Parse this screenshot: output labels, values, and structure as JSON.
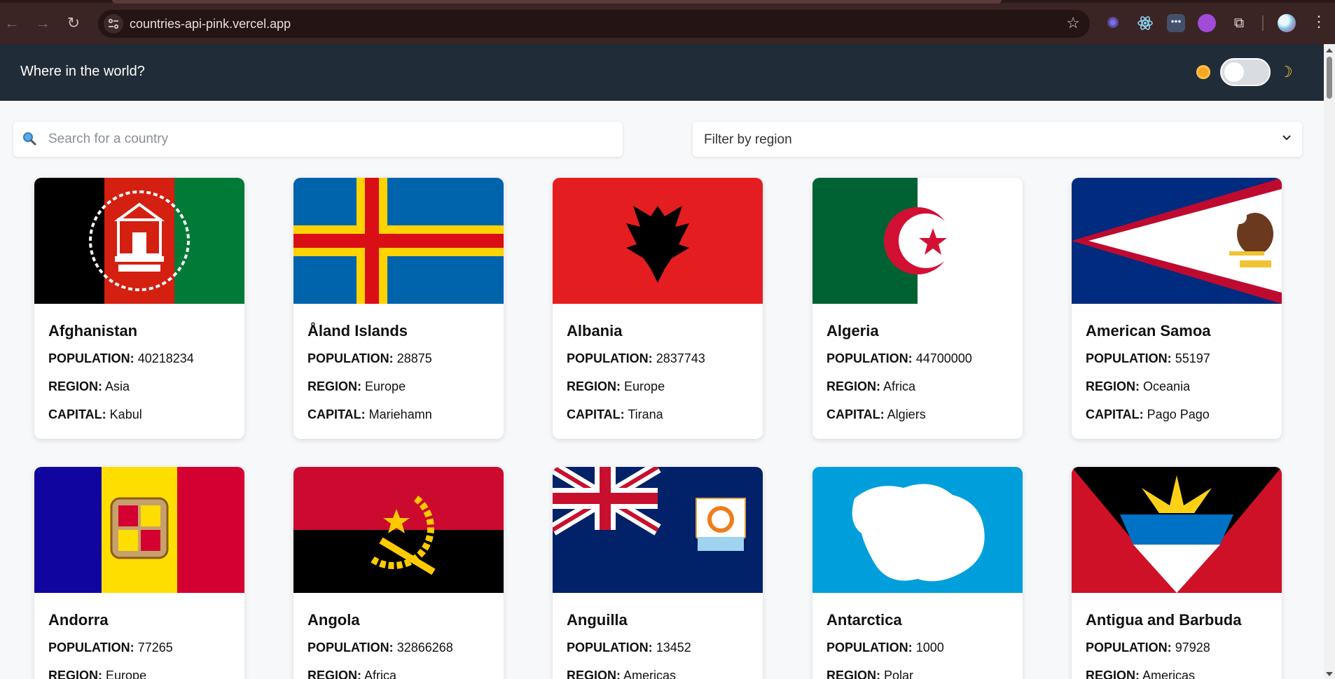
{
  "browser": {
    "url": "countries-api-pink.vercel.app",
    "nav_icons": [
      "back-arrow-icon",
      "forward-arrow-icon",
      "reload-icon"
    ],
    "extension_icons": [
      "sparkle-extension-icon",
      "react-devtools-icon",
      "dots-extension-icon",
      "globe-extension-icon",
      "puzzle-extensions-icon"
    ]
  },
  "header": {
    "title": "Where in the world?"
  },
  "controls": {
    "search_placeholder": "Search for a country",
    "filter_label": "Filter by region"
  },
  "labels": {
    "population": "POPULATION:",
    "region": "REGION:",
    "capital": "CAPITAL:"
  },
  "countries": [
    {
      "name": "Afghanistan",
      "population": "40218234",
      "region": "Asia",
      "capital": "Kabul"
    },
    {
      "name": "Åland Islands",
      "population": "28875",
      "region": "Europe",
      "capital": "Mariehamn"
    },
    {
      "name": "Albania",
      "population": "2837743",
      "region": "Europe",
      "capital": "Tirana"
    },
    {
      "name": "Algeria",
      "population": "44700000",
      "region": "Africa",
      "capital": "Algiers"
    },
    {
      "name": "American Samoa",
      "population": "55197",
      "region": "Oceania",
      "capital": "Pago Pago"
    },
    {
      "name": "Andorra",
      "population": "77265",
      "region": "Europe",
      "capital": ""
    },
    {
      "name": "Angola",
      "population": "32866268",
      "region": "Africa",
      "capital": ""
    },
    {
      "name": "Anguilla",
      "population": "13452",
      "region": "Americas",
      "capital": ""
    },
    {
      "name": "Antarctica",
      "population": "1000",
      "region": "Polar",
      "capital": ""
    },
    {
      "name": "Antigua and Barbuda",
      "population": "97928",
      "region": "Americas",
      "capital": ""
    }
  ],
  "colors": {
    "header_bg": "#202c37",
    "page_bg": "#f7f8fa",
    "card_bg": "#ffffff"
  }
}
